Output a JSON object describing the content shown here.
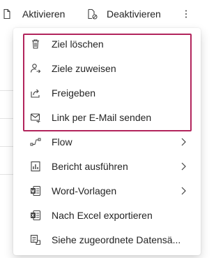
{
  "toolbar": {
    "activate_label": "Aktivieren",
    "deactivate_label": "Deaktivieren",
    "more_icon": "more-vertical-icon"
  },
  "menu": {
    "items": [
      {
        "label": "Ziel löschen",
        "icon": "trash-icon",
        "submenu": false
      },
      {
        "label": "Ziele zuweisen",
        "icon": "assign-user-icon",
        "submenu": false
      },
      {
        "label": "Freigeben",
        "icon": "share-icon",
        "submenu": false
      },
      {
        "label": "Link per E-Mail senden",
        "icon": "email-link-icon",
        "submenu": false
      },
      {
        "label": "Flow",
        "icon": "flow-icon",
        "submenu": true
      },
      {
        "label": "Bericht ausführen",
        "icon": "report-icon",
        "submenu": true
      },
      {
        "label": "Word-Vorlagen",
        "icon": "word-icon",
        "submenu": true
      },
      {
        "label": "Nach Excel exportieren",
        "icon": "excel-icon",
        "submenu": false
      },
      {
        "label": "Siehe zugeordnete Datensä...",
        "icon": "related-records-icon",
        "submenu": false
      }
    ],
    "highlight_color": "#b2245c"
  }
}
